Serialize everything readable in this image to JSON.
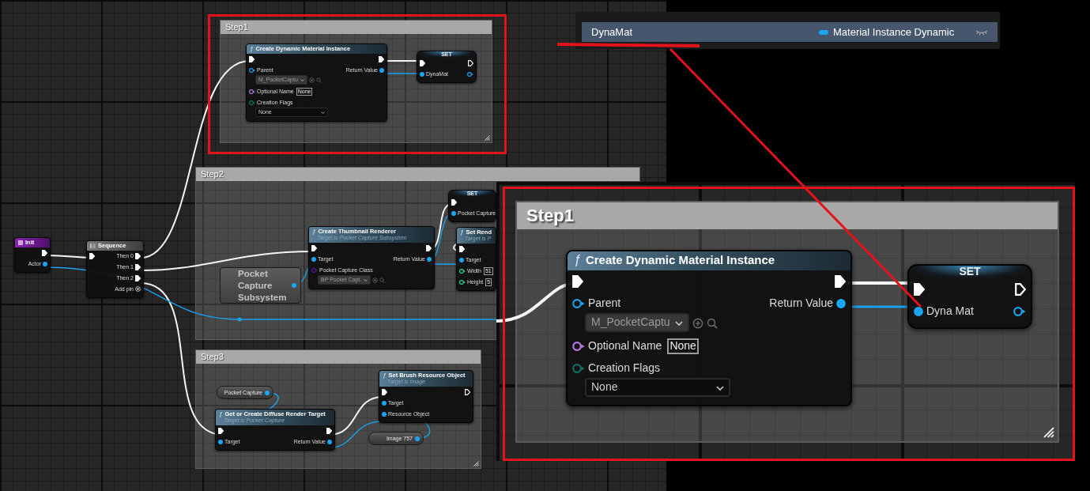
{
  "variables_panel": {
    "rows": [
      {
        "name": "DynaMat",
        "type": "Material Instance Dynamic",
        "selected": true
      }
    ]
  },
  "graph": {
    "comments": [
      {
        "title": "Step1"
      },
      {
        "title": "Step2"
      },
      {
        "title": "Step3"
      }
    ],
    "nodes": [
      {
        "kind": "event",
        "title": "Init",
        "rows": [
          {
            "right": {
              "kind": "exec",
              "connected": true
            }
          },
          {
            "right": {
              "kind": "object",
              "label": "Actor",
              "connected": true
            }
          }
        ]
      },
      {
        "kind": "sequence",
        "title": "Sequence",
        "rows": [
          {
            "left": {
              "kind": "exec",
              "connected": true
            },
            "right": {
              "kind": "exec",
              "label": "Then 0",
              "connected": true
            }
          },
          {
            "right": {
              "kind": "exec",
              "label": "Then 1",
              "connected": true
            }
          },
          {
            "right": {
              "kind": "exec",
              "label": "Then 2",
              "connected": true
            }
          },
          {
            "right": {
              "kind": "add",
              "label": "Add pin"
            }
          }
        ]
      },
      {
        "kind": "function",
        "glyph": "ƒ",
        "title": "Create Dynamic Material Instance",
        "rows": [
          {
            "left": {
              "kind": "exec",
              "connected": true
            },
            "right": {
              "kind": "exec",
              "connected": true
            }
          },
          {
            "left": {
              "kind": "object",
              "label": "Parent",
              "connected": false,
              "dropdown": "M_PocketCaptu"
            },
            "right": {
              "kind": "object",
              "label": "Return Value",
              "connected": true
            }
          },
          {
            "left": {
              "kind": "name",
              "label": "Optional Name",
              "connected": false,
              "value": "None"
            }
          },
          {
            "left": {
              "kind": "enum",
              "label": "Creation Flags",
              "connected": false,
              "dropdown": "None"
            }
          }
        ]
      },
      {
        "kind": "set",
        "title": "SET",
        "rows": [
          {
            "left": {
              "kind": "exec",
              "connected": true
            },
            "right": {
              "kind": "exec",
              "connected": false
            }
          },
          {
            "left": {
              "kind": "object",
              "label": "DynaMat",
              "connected": true
            },
            "right": {
              "kind": "object",
              "connected": false
            }
          }
        ]
      },
      {
        "kind": "subsystem",
        "title": "Pocket Capture Subsystem",
        "rows": [
          {
            "right": {
              "kind": "object",
              "connected": true
            }
          }
        ]
      },
      {
        "kind": "function",
        "glyph": "ƒ",
        "title": "Create Thumbnail Renderer",
        "subtitle": "Target is Pocket Capture Subsystem",
        "rows": [
          {
            "left": {
              "kind": "exec",
              "connected": true
            },
            "right": {
              "kind": "exec",
              "connected": true
            }
          },
          {
            "left": {
              "kind": "object",
              "label": "Target",
              "connected": true
            },
            "right": {
              "kind": "object",
              "label": "Return Value",
              "connected": true
            }
          },
          {
            "left": {
              "kind": "class",
              "label": "Pocket Capture Class",
              "connected": false,
              "dropdown": "BP Pocket Capt."
            }
          }
        ]
      },
      {
        "kind": "set",
        "title": "SET",
        "rows": [
          {
            "left": {
              "kind": "exec",
              "connected": true
            }
          },
          {
            "left": {
              "kind": "object",
              "label": "Pocket Capture",
              "connected": true
            }
          }
        ]
      },
      {
        "kind": "function",
        "glyph": "ƒ",
        "title": "Set Rend",
        "subtitle": "Target is P",
        "rows": [
          {
            "left": {
              "kind": "exec",
              "connected": true
            }
          },
          {
            "left": {
              "kind": "object",
              "label": "Target",
              "connected": true
            }
          },
          {
            "left": {
              "kind": "int",
              "label": "Width",
              "connected": false,
              "value": "51"
            }
          },
          {
            "left": {
              "kind": "int",
              "label": "Height",
              "connected": false,
              "value": "5"
            }
          }
        ]
      },
      {
        "kind": "variable",
        "title": "Pocket Capture",
        "rows": [
          {
            "right": {
              "kind": "object",
              "connected": true
            }
          }
        ]
      },
      {
        "kind": "function",
        "glyph": "ƒ",
        "title": "Get or Create Diffuse Render Target",
        "subtitle": "Target is Pocket Capture",
        "rows": [
          {
            "left": {
              "kind": "exec",
              "connected": true
            },
            "right": {
              "kind": "exec",
              "connected": true
            }
          },
          {
            "left": {
              "kind": "object",
              "label": "Target",
              "connected": true
            },
            "right": {
              "kind": "object",
              "label": "Return Value",
              "connected": true
            }
          }
        ]
      },
      {
        "kind": "function",
        "glyph": "ƒ",
        "title": "Set Brush Resource Object",
        "subtitle": "Target is Image",
        "rows": [
          {
            "left": {
              "kind": "exec",
              "connected": true
            },
            "right": {
              "kind": "exec",
              "connected": false
            }
          },
          {
            "left": {
              "kind": "object",
              "label": "Target",
              "connected": true
            }
          },
          {
            "left": {
              "kind": "object",
              "label": "Resource Object",
              "connected": true
            }
          }
        ]
      },
      {
        "kind": "variable",
        "title": "Image 757",
        "rows": [
          {
            "right": {
              "kind": "object",
              "connected": true
            }
          }
        ]
      }
    ]
  },
  "zoom_view": {
    "comment": {
      "title": "Step1"
    },
    "nodes": [
      {
        "kind": "function",
        "glyph": "ƒ",
        "title": "Create Dynamic Material Instance",
        "rows": [
          {
            "left": {
              "kind": "exec",
              "connected": true
            },
            "right": {
              "kind": "exec",
              "connected": true
            }
          },
          {
            "left": {
              "kind": "object",
              "label": "Parent",
              "connected": false,
              "dropdown": "M_PocketCaptu"
            },
            "right": {
              "kind": "object",
              "label": "Return Value",
              "connected": true
            }
          },
          {
            "left": {
              "kind": "name",
              "label": "Optional Name",
              "connected": false,
              "value": "None"
            }
          },
          {
            "left": {
              "kind": "enum",
              "label": "Creation Flags",
              "connected": false,
              "dropdown": "None"
            }
          }
        ]
      },
      {
        "kind": "set",
        "title": "SET",
        "rows": [
          {
            "left": {
              "kind": "exec",
              "connected": true
            },
            "right": {
              "kind": "exec",
              "connected": false
            }
          },
          {
            "left": {
              "kind": "object",
              "label": "Dyna Mat",
              "connected": true
            },
            "right": {
              "kind": "object",
              "connected": false
            }
          }
        ]
      }
    ]
  }
}
